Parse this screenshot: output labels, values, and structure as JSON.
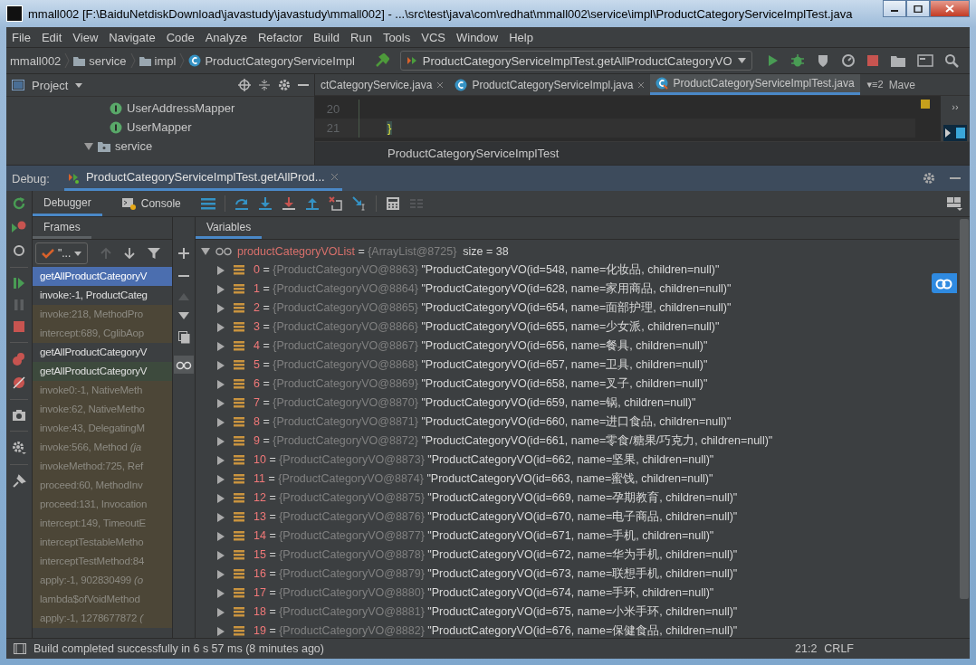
{
  "window": {
    "title": "mmall002 [F:\\BaiduNetdiskDownload\\javastudy\\javastudy\\mmall002] - ...\\src\\test\\java\\com\\redhat\\mmall002\\service\\impl\\ProductCategoryServiceImplTest.java"
  },
  "menu": [
    "File",
    "Edit",
    "View",
    "Navigate",
    "Code",
    "Analyze",
    "Refactor",
    "Build",
    "Run",
    "Tools",
    "VCS",
    "Window",
    "Help"
  ],
  "nav": {
    "breadcrumbs": [
      {
        "label": "mmall002",
        "kind": "module"
      },
      {
        "label": "service",
        "kind": "folder"
      },
      {
        "label": "impl",
        "kind": "folder"
      },
      {
        "label": "ProductCategoryServiceImpl",
        "kind": "class"
      }
    ],
    "run_config": "ProductCategoryServiceImplTest.getAllProductCategoryVO"
  },
  "project_panel": {
    "title": "Project",
    "tree": [
      {
        "label": "UserAddressMapper",
        "kind": "interface"
      },
      {
        "label": "UserMapper",
        "kind": "interface"
      },
      {
        "label": "service",
        "kind": "folder",
        "expanded": true
      }
    ]
  },
  "editor": {
    "tabs": [
      {
        "label": "ctCategoryService.java",
        "kind": "plain",
        "selected": false
      },
      {
        "label": "ProductCategoryServiceImpl.java",
        "kind": "class",
        "selected": false
      },
      {
        "label": "ProductCategoryServiceImplTest.java",
        "kind": "test",
        "selected": true
      }
    ],
    "tab_count": "▾≡2",
    "side_tab": "Mave",
    "more": "››",
    "lines": [
      {
        "number": "20"
      },
      {
        "number": "21",
        "code": "}"
      }
    ],
    "breadcrumb": "ProductCategoryServiceImplTest"
  },
  "debug": {
    "label": "Debug:",
    "session": "ProductCategoryServiceImplTest.getAllProd...",
    "tabs": [
      {
        "label": "Debugger",
        "selected": true
      },
      {
        "label": "Console",
        "selected": false
      }
    ],
    "frames_title": "Frames",
    "thread": "\"...",
    "frames": [
      {
        "text": "getAllProductCategoryV",
        "kind": "selected"
      },
      {
        "text": "invoke:-1, ProductCateg",
        "kind": "project"
      },
      {
        "text": "invoke:218, MethodPro",
        "kind": "library"
      },
      {
        "text": "intercept:689, CglibAop",
        "kind": "library"
      },
      {
        "text": "getAllProductCategoryV",
        "kind": "project"
      },
      {
        "text": "getAllProductCategoryV",
        "kind": "current"
      },
      {
        "text": "invoke0:-1, NativeMeth",
        "kind": "library"
      },
      {
        "text": "invoke:62, NativeMetho",
        "kind": "library"
      },
      {
        "text": "invoke:43, DelegatingM",
        "kind": "library"
      },
      {
        "text": "invoke:566, Method *(ja*",
        "kind": "library"
      },
      {
        "text": "invokeMethod:725, Ref",
        "kind": "library"
      },
      {
        "text": "proceed:60, MethodInv",
        "kind": "library"
      },
      {
        "text": "proceed:131, Invocation",
        "kind": "library"
      },
      {
        "text": "intercept:149, TimeoutE",
        "kind": "library"
      },
      {
        "text": "interceptTestableMetho",
        "kind": "library"
      },
      {
        "text": "interceptTestMethod:84",
        "kind": "library"
      },
      {
        "text": "apply:-1, 902830499 *(o*",
        "kind": "library"
      },
      {
        "text": "lambda$ofVoidMethod",
        "kind": "library"
      },
      {
        "text": "apply:-1, 1278677872 *(*",
        "kind": "library"
      }
    ],
    "variables_title": "Variables",
    "variables": {
      "name": "productCategoryVOList",
      "eq": "=",
      "ref": "{ArrayList@8725}",
      "size": "size = 38",
      "expanded": true,
      "children": [
        {
          "index": "0",
          "eq": "=",
          "ref": "{ProductCategoryVO@8863}",
          "value": "\"ProductCategoryVO(id=548, name=化妆品, children=null)\""
        },
        {
          "index": "1",
          "eq": "=",
          "ref": "{ProductCategoryVO@8864}",
          "value": "\"ProductCategoryVO(id=628, name=家用商品, children=null)\""
        },
        {
          "index": "2",
          "eq": "=",
          "ref": "{ProductCategoryVO@8865}",
          "value": "\"ProductCategoryVO(id=654, name=面部护理, children=null)\""
        },
        {
          "index": "3",
          "eq": "=",
          "ref": "{ProductCategoryVO@8866}",
          "value": "\"ProductCategoryVO(id=655, name=少女派, children=null)\""
        },
        {
          "index": "4",
          "eq": "=",
          "ref": "{ProductCategoryVO@8867}",
          "value": "\"ProductCategoryVO(id=656, name=餐具, children=null)\""
        },
        {
          "index": "5",
          "eq": "=",
          "ref": "{ProductCategoryVO@8868}",
          "value": "\"ProductCategoryVO(id=657, name=卫具, children=null)\""
        },
        {
          "index": "6",
          "eq": "=",
          "ref": "{ProductCategoryVO@8869}",
          "value": "\"ProductCategoryVO(id=658, name=叉子, children=null)\""
        },
        {
          "index": "7",
          "eq": "=",
          "ref": "{ProductCategoryVO@8870}",
          "value": "\"ProductCategoryVO(id=659, name=锅, children=null)\""
        },
        {
          "index": "8",
          "eq": "=",
          "ref": "{ProductCategoryVO@8871}",
          "value": "\"ProductCategoryVO(id=660, name=进口食品, children=null)\""
        },
        {
          "index": "9",
          "eq": "=",
          "ref": "{ProductCategoryVO@8872}",
          "value": "\"ProductCategoryVO(id=661, name=零食/糖果/巧克力, children=null)\""
        },
        {
          "index": "10",
          "eq": "=",
          "ref": "{ProductCategoryVO@8873}",
          "value": "\"ProductCategoryVO(id=662, name=坚果, children=null)\""
        },
        {
          "index": "11",
          "eq": "=",
          "ref": "{ProductCategoryVO@8874}",
          "value": "\"ProductCategoryVO(id=663, name=蜜饯, children=null)\""
        },
        {
          "index": "12",
          "eq": "=",
          "ref": "{ProductCategoryVO@8875}",
          "value": "\"ProductCategoryVO(id=669, name=孕期教育, children=null)\""
        },
        {
          "index": "13",
          "eq": "=",
          "ref": "{ProductCategoryVO@8876}",
          "value": "\"ProductCategoryVO(id=670, name=电子商品, children=null)\""
        },
        {
          "index": "14",
          "eq": "=",
          "ref": "{ProductCategoryVO@8877}",
          "value": "\"ProductCategoryVO(id=671, name=手机, children=null)\""
        },
        {
          "index": "15",
          "eq": "=",
          "ref": "{ProductCategoryVO@8878}",
          "value": "\"ProductCategoryVO(id=672, name=华为手机, children=null)\""
        },
        {
          "index": "16",
          "eq": "=",
          "ref": "{ProductCategoryVO@8879}",
          "value": "\"ProductCategoryVO(id=673, name=联想手机, children=null)\""
        },
        {
          "index": "17",
          "eq": "=",
          "ref": "{ProductCategoryVO@8880}",
          "value": "\"ProductCategoryVO(id=674, name=手环, children=null)\""
        },
        {
          "index": "18",
          "eq": "=",
          "ref": "{ProductCategoryVO@8881}",
          "value": "\"ProductCategoryVO(id=675, name=小米手环, children=null)\""
        },
        {
          "index": "19",
          "eq": "=",
          "ref": "{ProductCategoryVO@8882}",
          "value": "\"ProductCategoryVO(id=676, name=保健食品, children=null)\""
        }
      ]
    }
  },
  "status_bar": {
    "message": "Build completed successfully in 6 s 57 ms (8 minutes ago)",
    "position": "21:2",
    "line_separator": "CRLF"
  }
}
